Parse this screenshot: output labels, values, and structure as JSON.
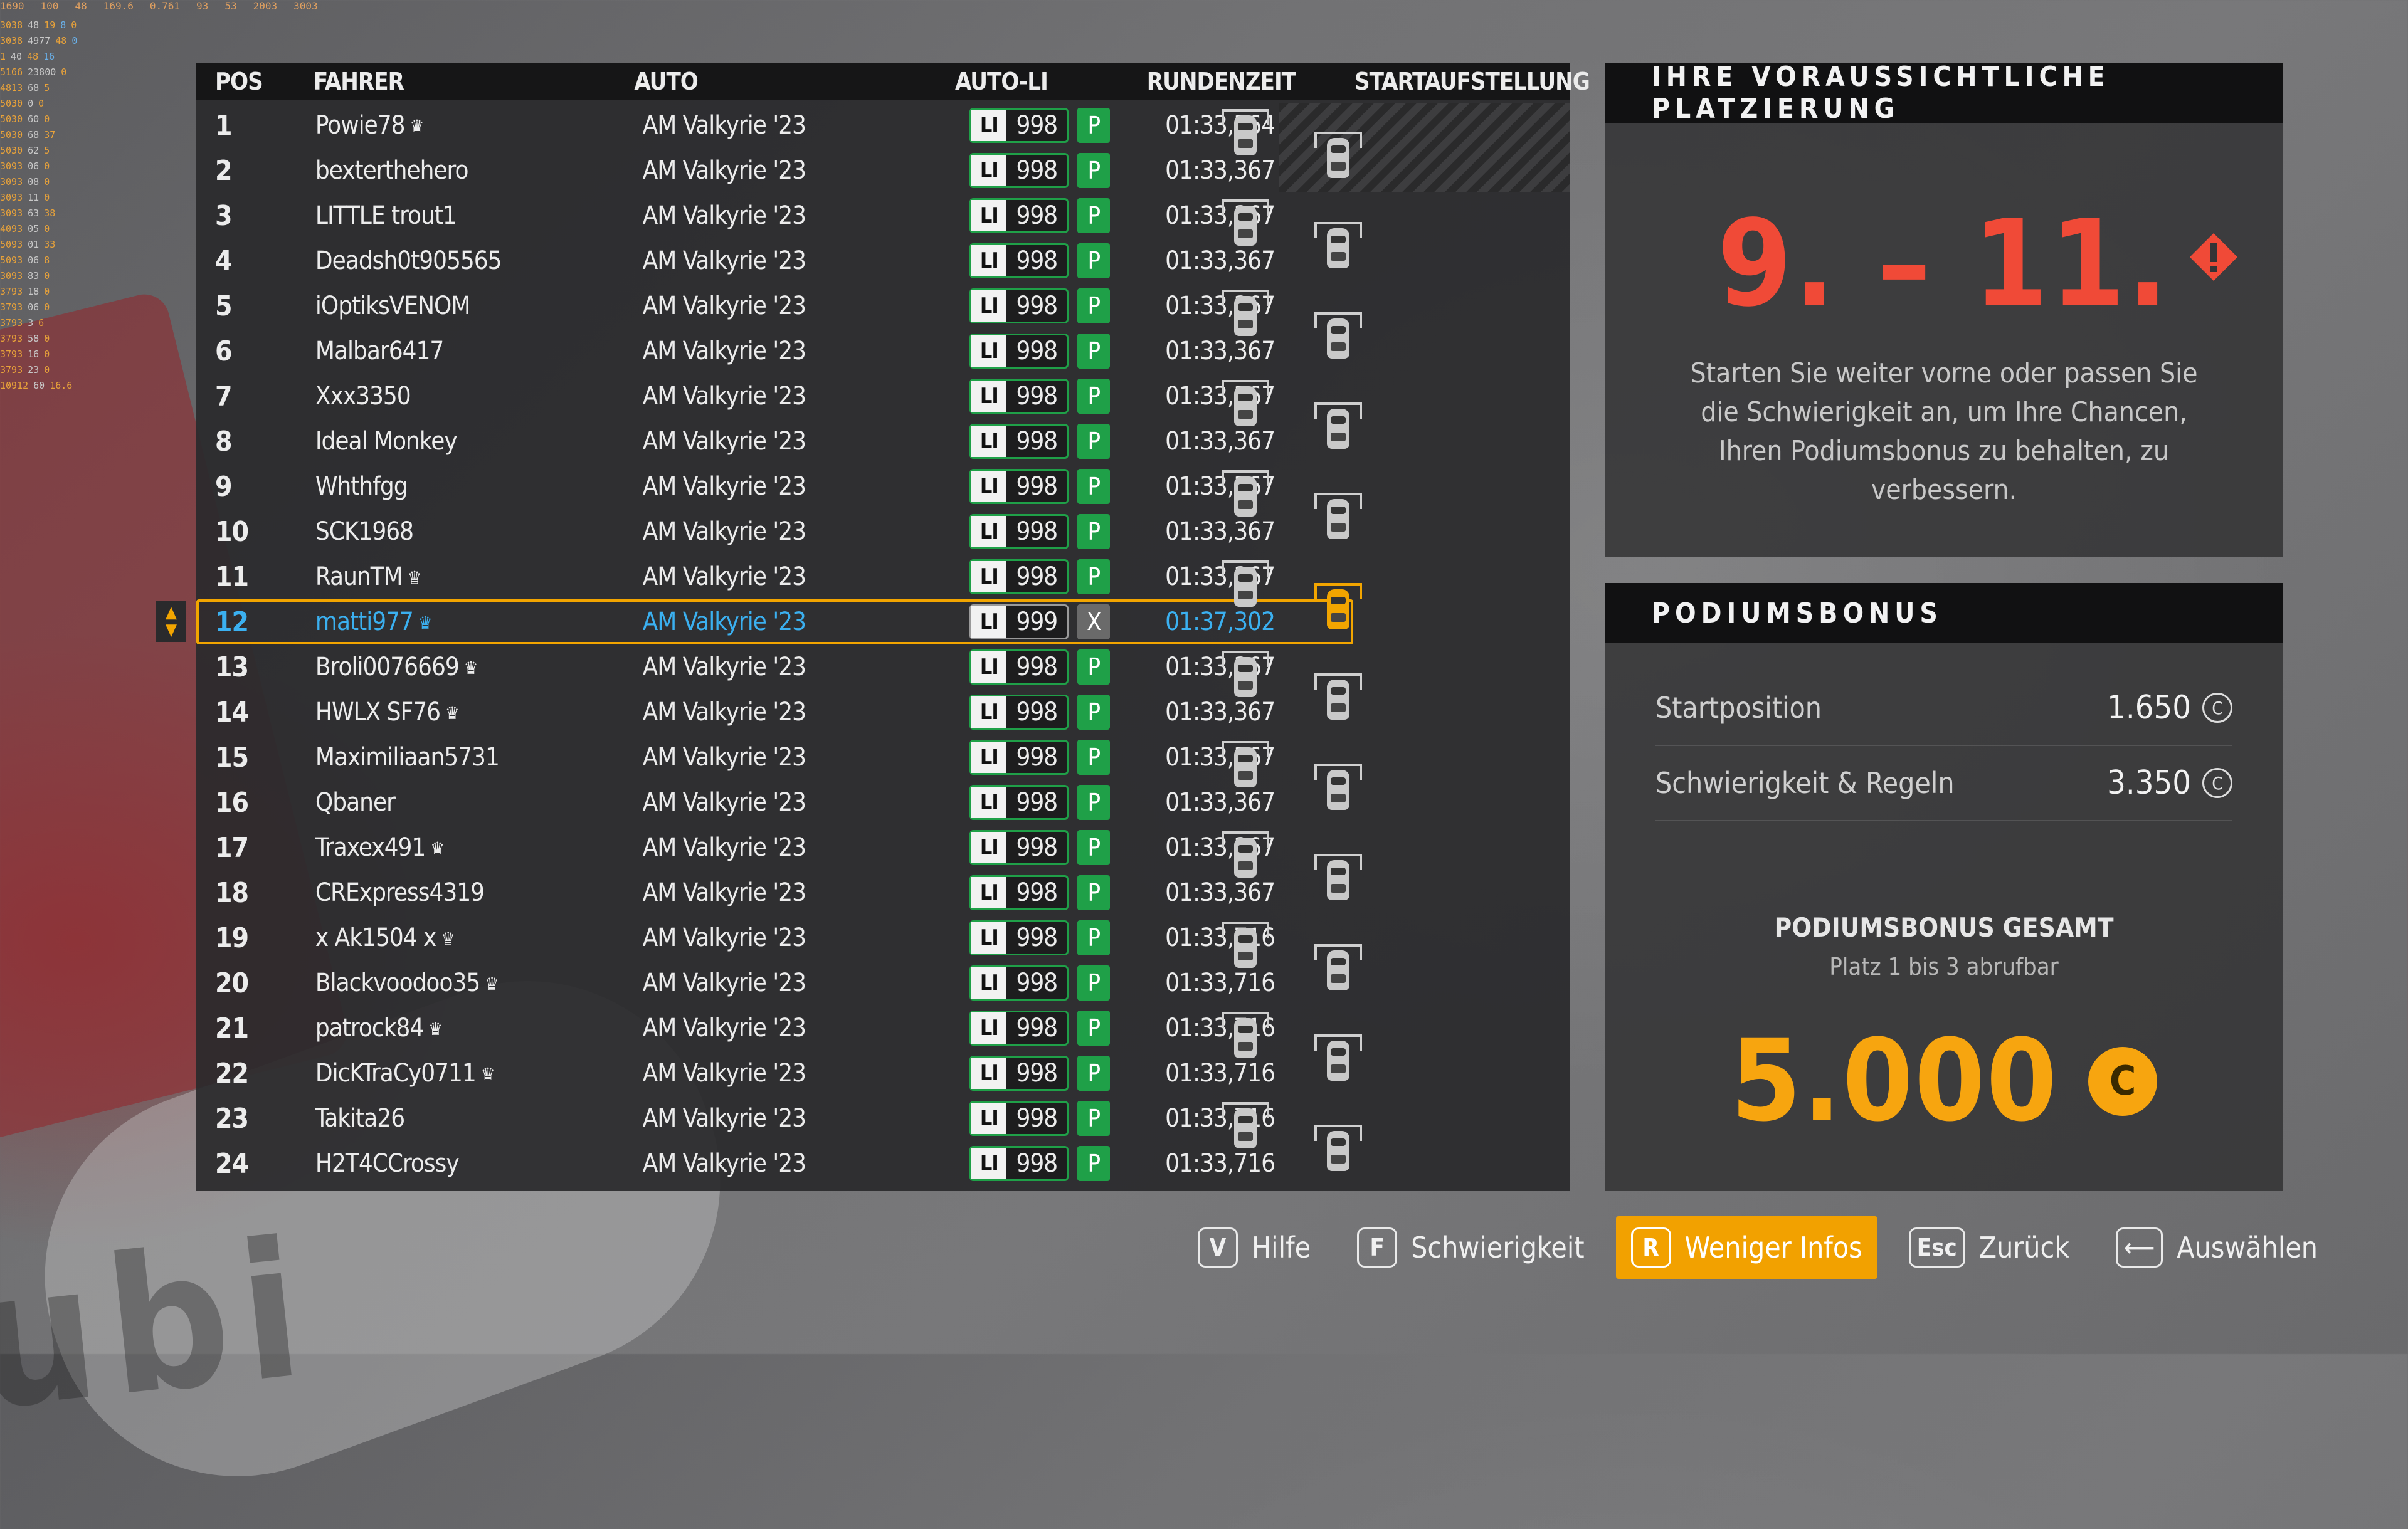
{
  "overlay": {
    "top": [
      "1690",
      "100",
      "48",
      "169.6",
      "0.761",
      "93",
      "53",
      "2003",
      "3003"
    ],
    "rows": [
      [
        "3038",
        "48",
        "19",
        "8",
        "0"
      ],
      [
        "3038",
        "4977",
        "48",
        "0"
      ],
      [
        "1",
        "40",
        "48",
        "16"
      ],
      [
        "5166",
        "23800",
        "0"
      ],
      [
        "4813",
        "68",
        "5"
      ],
      [
        "5030",
        "0",
        "0"
      ],
      [
        "5030",
        "60",
        "0"
      ],
      [
        "5030",
        "68",
        "37"
      ],
      [
        "5030",
        "62",
        "5"
      ],
      [
        "3093",
        "06",
        "0"
      ],
      [
        "3093",
        "08",
        "0"
      ],
      [
        "3093",
        "11",
        "0"
      ],
      [
        "3093",
        "63",
        "38"
      ],
      [
        "4093",
        "05",
        "0"
      ],
      [
        "5093",
        "01",
        "33"
      ],
      [
        "5093",
        "06",
        "8"
      ],
      [
        "3093",
        "83",
        "0"
      ],
      [
        "3793",
        "18",
        "0"
      ],
      [
        "3793",
        "06",
        "0"
      ],
      [
        "3793",
        "3",
        "6"
      ],
      [
        "3793",
        "58",
        "0"
      ],
      [
        "3793",
        "16",
        "0"
      ],
      [
        "3793",
        "23",
        "0"
      ],
      [
        "10912",
        "60",
        "16.6"
      ]
    ]
  },
  "table": {
    "headers": {
      "pos": "POS",
      "driver": "FAHRER",
      "car": "AUTO",
      "auto_li": "AUTO-LI",
      "lap_time": "RUNDENZEIT",
      "grid": "STARTAUFSTELLUNG"
    },
    "rows": [
      {
        "pos": "1",
        "name": "Powie78",
        "crown": "♛",
        "car": "AM Valkyrie '23",
        "li": "LI",
        "li_val": "998",
        "status": "P",
        "time": "01:33,364"
      },
      {
        "pos": "2",
        "name": "bexterthehero",
        "crown": "",
        "car": "AM Valkyrie '23",
        "li": "LI",
        "li_val": "998",
        "status": "P",
        "time": "01:33,367"
      },
      {
        "pos": "3",
        "name": "LITTLE trout1",
        "crown": "",
        "car": "AM Valkyrie '23",
        "li": "LI",
        "li_val": "998",
        "status": "P",
        "time": "01:33,367"
      },
      {
        "pos": "4",
        "name": "Deadsh0t905565",
        "crown": "",
        "car": "AM Valkyrie '23",
        "li": "LI",
        "li_val": "998",
        "status": "P",
        "time": "01:33,367"
      },
      {
        "pos": "5",
        "name": "iOptiksVENOM",
        "crown": "",
        "car": "AM Valkyrie '23",
        "li": "LI",
        "li_val": "998",
        "status": "P",
        "time": "01:33,367"
      },
      {
        "pos": "6",
        "name": "Malbar6417",
        "crown": "",
        "car": "AM Valkyrie '23",
        "li": "LI",
        "li_val": "998",
        "status": "P",
        "time": "01:33,367"
      },
      {
        "pos": "7",
        "name": "Xxx3350",
        "crown": "",
        "car": "AM Valkyrie '23",
        "li": "LI",
        "li_val": "998",
        "status": "P",
        "time": "01:33,367"
      },
      {
        "pos": "8",
        "name": "Ideal Monkey",
        "crown": "",
        "car": "AM Valkyrie '23",
        "li": "LI",
        "li_val": "998",
        "status": "P",
        "time": "01:33,367"
      },
      {
        "pos": "9",
        "name": "Whthfgg",
        "crown": "",
        "car": "AM Valkyrie '23",
        "li": "LI",
        "li_val": "998",
        "status": "P",
        "time": "01:33,367"
      },
      {
        "pos": "10",
        "name": "SCK1968",
        "crown": "",
        "car": "AM Valkyrie '23",
        "li": "LI",
        "li_val": "998",
        "status": "P",
        "time": "01:33,367"
      },
      {
        "pos": "11",
        "name": "RaunTM",
        "crown": "♛",
        "car": "AM Valkyrie '23",
        "li": "LI",
        "li_val": "998",
        "status": "P",
        "time": "01:33,367"
      },
      {
        "pos": "12",
        "name": "matti977",
        "crown": "♛",
        "car": "AM Valkyrie '23",
        "li": "LI",
        "li_val": "999",
        "status": "X",
        "time": "01:37,302",
        "me": true
      },
      {
        "pos": "13",
        "name": "Broli0076669",
        "crown": "♛",
        "car": "AM Valkyrie '23",
        "li": "LI",
        "li_val": "998",
        "status": "P",
        "time": "01:33,367"
      },
      {
        "pos": "14",
        "name": "HWLX SF76",
        "crown": "♛",
        "car": "AM Valkyrie '23",
        "li": "LI",
        "li_val": "998",
        "status": "P",
        "time": "01:33,367"
      },
      {
        "pos": "15",
        "name": "Maximiliaan5731",
        "crown": "",
        "car": "AM Valkyrie '23",
        "li": "LI",
        "li_val": "998",
        "status": "P",
        "time": "01:33,367"
      },
      {
        "pos": "16",
        "name": "Qbaner",
        "crown": "",
        "car": "AM Valkyrie '23",
        "li": "LI",
        "li_val": "998",
        "status": "P",
        "time": "01:33,367"
      },
      {
        "pos": "17",
        "name": "Traxex491",
        "crown": "♛",
        "car": "AM Valkyrie '23",
        "li": "LI",
        "li_val": "998",
        "status": "P",
        "time": "01:33,367"
      },
      {
        "pos": "18",
        "name": "CRExpress4319",
        "crown": "",
        "car": "AM Valkyrie '23",
        "li": "LI",
        "li_val": "998",
        "status": "P",
        "time": "01:33,367"
      },
      {
        "pos": "19",
        "name": "x Ak1504 x",
        "crown": "♛",
        "car": "AM Valkyrie '23",
        "li": "LI",
        "li_val": "998",
        "status": "P",
        "time": "01:33,716"
      },
      {
        "pos": "20",
        "name": "Blackvoodoo35",
        "crown": "♛",
        "car": "AM Valkyrie '23",
        "li": "LI",
        "li_val": "998",
        "status": "P",
        "time": "01:33,716"
      },
      {
        "pos": "21",
        "name": "patrock84",
        "crown": "♛",
        "car": "AM Valkyrie '23",
        "li": "LI",
        "li_val": "998",
        "status": "P",
        "time": "01:33,716"
      },
      {
        "pos": "22",
        "name": "DicKTraCy0711",
        "crown": "♛",
        "car": "AM Valkyrie '23",
        "li": "LI",
        "li_val": "998",
        "status": "P",
        "time": "01:33,716"
      },
      {
        "pos": "23",
        "name": "Takita26",
        "crown": "",
        "car": "AM Valkyrie '23",
        "li": "LI",
        "li_val": "998",
        "status": "P",
        "time": "01:33,716"
      },
      {
        "pos": "24",
        "name": "H2T4CCrossy",
        "crown": "",
        "car": "AM Valkyrie '23",
        "li": "LI",
        "li_val": "998",
        "status": "P",
        "time": "01:33,716"
      }
    ],
    "player_position": "12",
    "row_icons": {
      "crown": "crown-icon",
      "grid_car": "car-icon",
      "sort": "sort-arrows-icon"
    }
  },
  "prediction": {
    "title": "IHRE VORAUSSICHTLICHE PLATZIERUNG",
    "range": "9. – 11.",
    "warning_icon": "warning-icon",
    "text": "Starten Sie weiter vorne oder passen Sie die Schwierigkeit an, um Ihre Chancen, Ihren Podiumsbonus zu behalten, zu verbessern."
  },
  "podium": {
    "title": "PODIUMSBONUS",
    "lines": [
      {
        "label": "Startposition",
        "value": "1.650",
        "coin": "C"
      },
      {
        "label": "Schwierigkeit & Regeln",
        "value": "3.350",
        "coin": "C"
      }
    ],
    "total_title": "PODIUMSBONUS GESAMT",
    "total_sub": "Platz 1 bis 3 abrufbar",
    "total_value": "5.000",
    "total_coin": "C"
  },
  "bottom_bar": [
    {
      "key": "V",
      "label": "Hilfe"
    },
    {
      "key": "F",
      "label": "Schwierigkeit"
    },
    {
      "key": "R",
      "label": "Weniger Infos",
      "active": true
    },
    {
      "key": "Esc",
      "label": "Zurück"
    },
    {
      "key": "⟵",
      "label": "Auswählen"
    }
  ],
  "colors": {
    "accent": "#f2a500",
    "green": "#1fa048",
    "prediction_red": "#f04a37",
    "player_blue": "#3bb0f0",
    "bonus_gold": "#f7a50f"
  }
}
